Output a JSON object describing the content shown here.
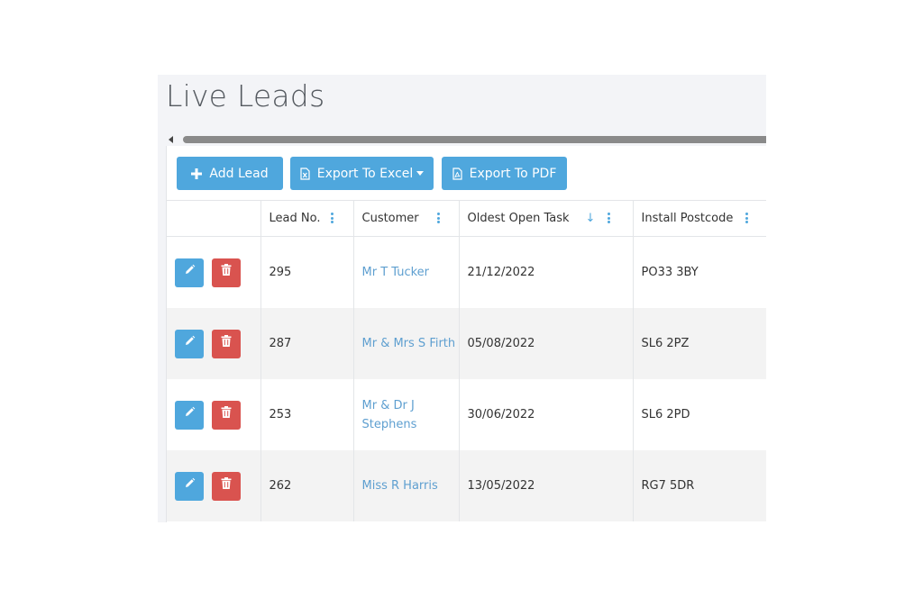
{
  "page": {
    "title": "Live Leads"
  },
  "toolbar": {
    "add_label": "Add Lead",
    "excel_label": "Export To Excel",
    "pdf_label": "Export To PDF"
  },
  "table": {
    "columns": [
      "",
      "Lead No.",
      "Customer",
      "Oldest Open Task",
      "Install Postcode"
    ],
    "rows": [
      {
        "lead_no": "295",
        "customer": "Mr T Tucker",
        "oldest_task": "21/12/2022",
        "postcode": "PO33 3BY"
      },
      {
        "lead_no": "287",
        "customer": "Mr & Mrs S Firth",
        "oldest_task": "05/08/2022",
        "postcode": "SL6 2PZ"
      },
      {
        "lead_no": "253",
        "customer": "Mr & Dr J Stephens",
        "oldest_task": "30/06/2022",
        "postcode": "SL6 2PD"
      },
      {
        "lead_no": "262",
        "customer": "Miss R Harris",
        "oldest_task": "13/05/2022",
        "postcode": "RG7 5DR"
      }
    ]
  },
  "icons": {
    "add": "plus-icon",
    "excel": "excel-file-icon",
    "pdf": "pdf-file-icon",
    "caret": "caret-down-icon",
    "sort": "sort-down-arrow-icon",
    "column_menu": "kebab-menu-icon",
    "edit": "pencil-icon",
    "delete": "trash-icon"
  },
  "colors": {
    "primary": "#4fa7dd",
    "danger": "#d9534f",
    "link": "#5e9fd0"
  }
}
